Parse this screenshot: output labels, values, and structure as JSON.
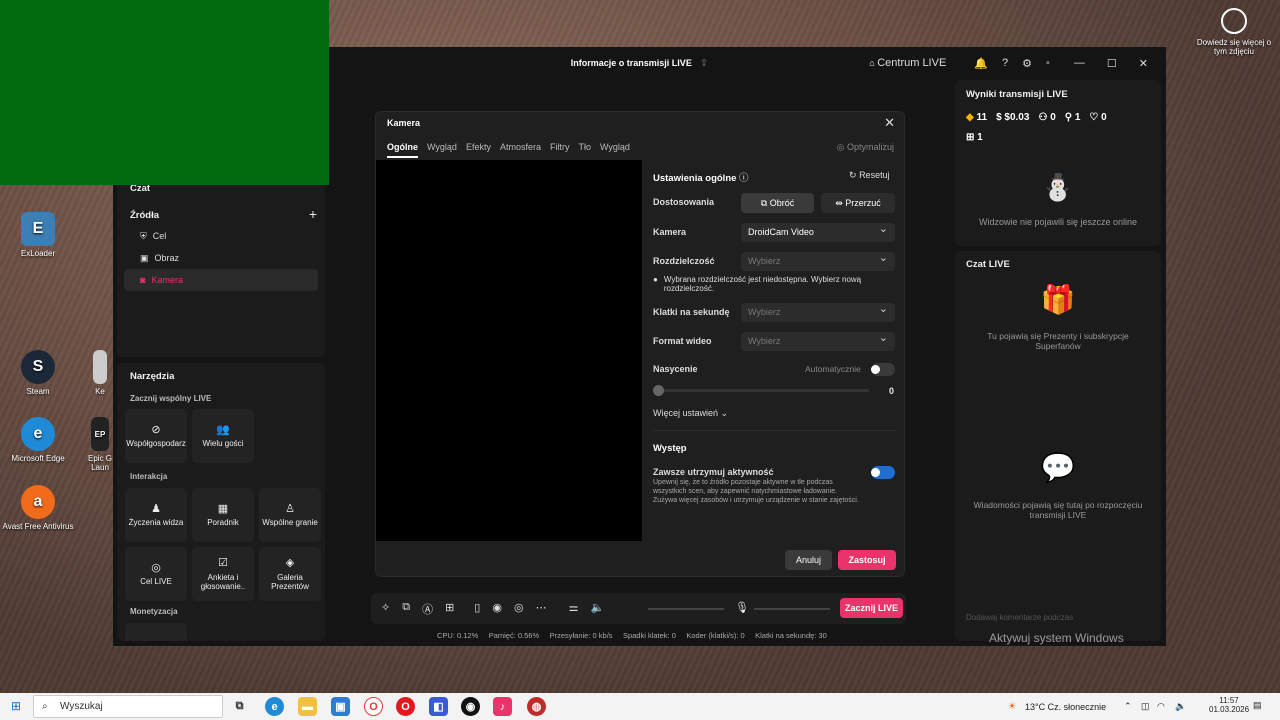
{
  "desktop": {
    "icons": [
      {
        "label": "ExLoader",
        "icon": "exloader-icon",
        "color": "#3d7fb5"
      },
      {
        "label": "Steam",
        "icon": "steam-icon",
        "color": "#1b2838"
      },
      {
        "label": "Microsoft Edge",
        "icon": "edge-icon",
        "color": "#1f8ad6"
      },
      {
        "label": "Avast Free Antivirus",
        "icon": "avast-icon",
        "color": "#f06b1a"
      }
    ],
    "partial_icons": [
      {
        "label": "Ke",
        "icon": "app-icon"
      },
      {
        "label": "Epic G Laun",
        "icon": "epic-icon"
      }
    ],
    "learn_more": "Dowiedz się więcej o tym zdjęciu",
    "activate_watermark": "Aktywuj system Windows"
  },
  "app": {
    "title": "Informacje o transmisji LIVE",
    "centrum": "Centrum LIVE",
    "left": {
      "czat": "Czat",
      "sources_title": "Źródła",
      "sources": [
        {
          "label": "Cel",
          "icon": "shield-icon"
        },
        {
          "label": "Obraz",
          "icon": "image-icon"
        },
        {
          "label": "Kamera",
          "icon": "camera-icon"
        }
      ],
      "tools_title": "Narzędzia",
      "coop_title": "Zacznij wspólny LIVE",
      "coop": [
        {
          "label": "Współgospodarz",
          "icon": "link-icon"
        },
        {
          "label": "Wielu gości",
          "icon": "users-icon"
        }
      ],
      "interaction_title": "Interakcja",
      "interaction": [
        {
          "label": "Życzenia widza",
          "icon": "wish-icon"
        },
        {
          "label": "Poradnik",
          "icon": "guide-icon"
        },
        {
          "label": "Wspólne granie",
          "icon": "game-icon"
        },
        {
          "label": "Cel LIVE",
          "icon": "target-icon"
        },
        {
          "label": "Ankieta i głosowanie..",
          "icon": "poll-icon"
        },
        {
          "label": "Galeria Prezentów",
          "icon": "gift-gallery-icon"
        }
      ],
      "monetization_title": "Monetyzacja"
    },
    "right": {
      "results_title": "Wyniki transmisji LIVE",
      "stats": [
        {
          "icon": "diamond-icon",
          "value": "11"
        },
        {
          "icon": "dollar-icon",
          "value": "$0.03"
        },
        {
          "icon": "viewers-icon",
          "value": "0"
        },
        {
          "icon": "follower-icon",
          "value": "1"
        },
        {
          "icon": "heart-icon",
          "value": "0"
        }
      ],
      "gifts_value": "1",
      "no_viewers": "Widzowie nie pojawili się jeszcze online",
      "chat_title": "Czat LIVE",
      "gifts_hint": "Tu pojawią się Prezenty i subskrypcje Superfanów",
      "messages_hint": "Wiadomości pojawią się tutaj po rozpoczęciu transmisji LIVE",
      "comment_placeholder": "Dodawaj komentarze podczas"
    },
    "go_live": "Zacznij LIVE",
    "status": {
      "cpu": "CPU:  0.12%",
      "mem": "Pamięć:  0.56%",
      "bw": "Przesyłanie:  0 kb/s",
      "drops": "Spadki klatek:  0",
      "enc": "Koder (klatki/s):  0",
      "fps": "Klatki na sekundę:  30"
    }
  },
  "dialog": {
    "title": "Kamera",
    "tabs": [
      "Ogólne",
      "Wygląd",
      "Efekty",
      "Atmosfera",
      "Filtry",
      "Tło",
      "Wygląd"
    ],
    "optimize": "Optymalizuj",
    "general_title": "Ustawienia ogólne",
    "reset": "Resetuj",
    "adjust_label": "Dostosowania",
    "rotate": "Obróć",
    "flip": "Przerzuć",
    "camera_label": "Kamera",
    "camera_value": "DroidCam Video",
    "res_label": "Rozdzielczość",
    "res_placeholder": "Wybierz",
    "res_warning": "Wybrana rozdzielczość jest niedostępna. Wybierz nową rozdzielczość.",
    "fps_label": "Klatki na sekundę",
    "fps_placeholder": "Wybierz",
    "format_label": "Format wideo",
    "format_placeholder": "Wybierz",
    "saturation_label": "Nasycenie",
    "auto_label": "Automatycznie",
    "saturation_value": "0",
    "more_settings": "Więcej ustawień",
    "performance_title": "Występ",
    "keep_active": "Zawsze utrzymuj aktywność",
    "keep_active_desc": "Upewnij się, że to źródło pozostaje aktywne w tle podczas wszystkich scen, aby zapewnić natychmiastowe ładowanie. Zużywa więcej zasobów i utrzymuje urządzenie w stanie zajętości.",
    "cancel": "Anuluj",
    "apply": "Zastosuj",
    "accent": "#e8336b",
    "toggle_color": "#1f6fd1"
  },
  "taskbar": {
    "search": "Wyszukaj",
    "weather": "13°C  Cz. słonecznie",
    "time": "11:57",
    "date": "01.03.2026"
  }
}
